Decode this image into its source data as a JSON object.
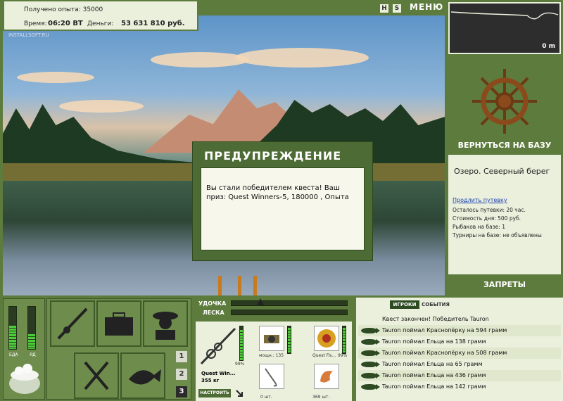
{
  "status": {
    "exp_label": "Получено опыта:",
    "exp_value": "35000",
    "time_label": "Время:",
    "time_value": "06:20 ВТ",
    "money_label": "Деньги:",
    "money_value": "53 631 810 руб.",
    "watermark": "INSTALLSOFT.RU"
  },
  "top": {
    "icon1": "H",
    "icon2": "S",
    "menu_label": "МЕНЮ"
  },
  "depth": {
    "value": "0 m"
  },
  "right": {
    "base_button": "ВЕРНУТЬСЯ НА БАЗУ",
    "location": "Озеро. Северный берег",
    "extend_link": "Продлить путевку",
    "lines": [
      "Осталось путевки: 20 час.",
      "Стоимость дня: 500 руб.",
      "Рыбаков на базе: 1",
      "Турниры на базе: не объявлены"
    ],
    "bans_button": "ЗАПРЕТЫ"
  },
  "dialog": {
    "title": "ПРЕДУПРЕЖДЕНИЕ",
    "message": "Вы стали победителем квеста! Ваш приз: Quest Winners-5, 180000 , Опыта"
  },
  "meters": {
    "food_label": "ЕДА",
    "poison_label": "ЯД",
    "food_level": 0.55,
    "poison_level": 0.35
  },
  "pages": [
    "1",
    "2",
    "3"
  ],
  "rodbars": {
    "rod_label": "УДОЧКА",
    "line_label": "ЛЕСКА"
  },
  "tackle": {
    "rod_name": "Quest Win...",
    "rod_weight": "355 кг",
    "percent1": "99%",
    "percent2": "99%",
    "configure": "НАСТРОИТЬ",
    "reel_label": "мощн.: 135",
    "line_label": "Quest Fis...",
    "hook_label": "0 шт.",
    "bait_label": "369 шт."
  },
  "chat": {
    "tab_players": "ИГРОКИ",
    "tab_events": "СОБЫТИЯ",
    "lines": [
      "Квест закончен! Победитель Tauron",
      "Tauron поймал Краснопёрку на 594 грамм",
      "Tauron поймал Ельца на 138 грамм",
      "Tauron поймал Краснопёрку на 508 грамм",
      "Tauron поймал Ельца на 65 грамм",
      "Tauron поймал Ельца на 436 грамм",
      "Tauron поймал Ельца на 142 грамм"
    ]
  },
  "colors": {
    "panel_green": "#5d7b3d",
    "cream": "#eaf0dc",
    "meter_green": "#4ccd3a"
  }
}
